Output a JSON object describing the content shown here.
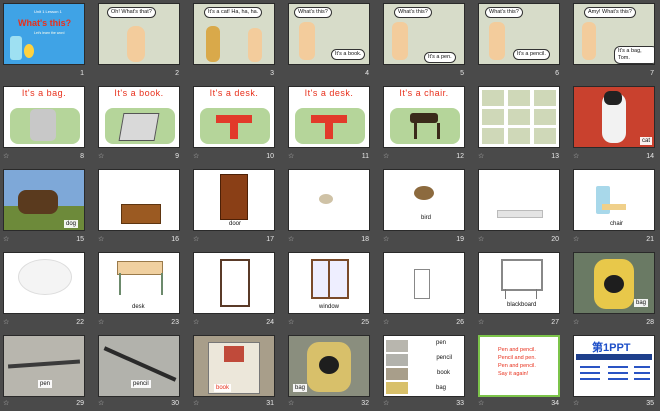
{
  "slides": [
    {
      "n": "1",
      "title": "What's this?",
      "small_top": "Unit 1 Lesson 1",
      "small_mid": "Let's learn the word"
    },
    {
      "n": "2",
      "bubble": "Oh! What's that?"
    },
    {
      "n": "3",
      "bubble": "It's a cat! Ha, ha, ha."
    },
    {
      "n": "4",
      "bubble": "What's this?",
      "bubble2": "It's a book."
    },
    {
      "n": "5",
      "bubble": "What's this?",
      "bubble2": "It's a pen."
    },
    {
      "n": "6",
      "bubble": "What's this?",
      "bubble2": "It's a pencil."
    },
    {
      "n": "7",
      "bubble": "Amy! What's this?",
      "bubble2": "It's a bag, Tom."
    },
    {
      "n": "8",
      "text": "It's  a  bag."
    },
    {
      "n": "9",
      "text": "It's  a  book."
    },
    {
      "n": "10",
      "text": "It's  a  desk."
    },
    {
      "n": "11",
      "text": "It's  a  desk."
    },
    {
      "n": "12",
      "text": "It's  a  chair."
    },
    {
      "n": "13"
    },
    {
      "n": "14",
      "caption": "cat"
    },
    {
      "n": "15",
      "caption": "dog"
    },
    {
      "n": "16"
    },
    {
      "n": "17",
      "caption": "door"
    },
    {
      "n": "18"
    },
    {
      "n": "19",
      "caption": "bird"
    },
    {
      "n": "20"
    },
    {
      "n": "21",
      "caption": "chair"
    },
    {
      "n": "22"
    },
    {
      "n": "23",
      "caption": "desk"
    },
    {
      "n": "24"
    },
    {
      "n": "25",
      "caption": "window"
    },
    {
      "n": "26"
    },
    {
      "n": "27",
      "caption": "blackboard"
    },
    {
      "n": "28",
      "caption": "bag"
    },
    {
      "n": "29",
      "caption": "pen"
    },
    {
      "n": "30",
      "caption": "pencil"
    },
    {
      "n": "31",
      "caption": "book"
    },
    {
      "n": "32",
      "caption": "bag"
    },
    {
      "n": "33",
      "words": [
        "pen",
        "pencil",
        "book",
        "bag"
      ]
    },
    {
      "n": "34",
      "chant": [
        "Pen and pencil.",
        "Pencil and pen.",
        "Pen and pencil.",
        "Say it again!"
      ]
    },
    {
      "n": "35",
      "brand": "第1PPT"
    }
  ],
  "star_glyph": "☆",
  "colors": {
    "background": "#4a4a4a",
    "red_text": "#e8301c",
    "slide1_bg": "#3aa0e0"
  }
}
